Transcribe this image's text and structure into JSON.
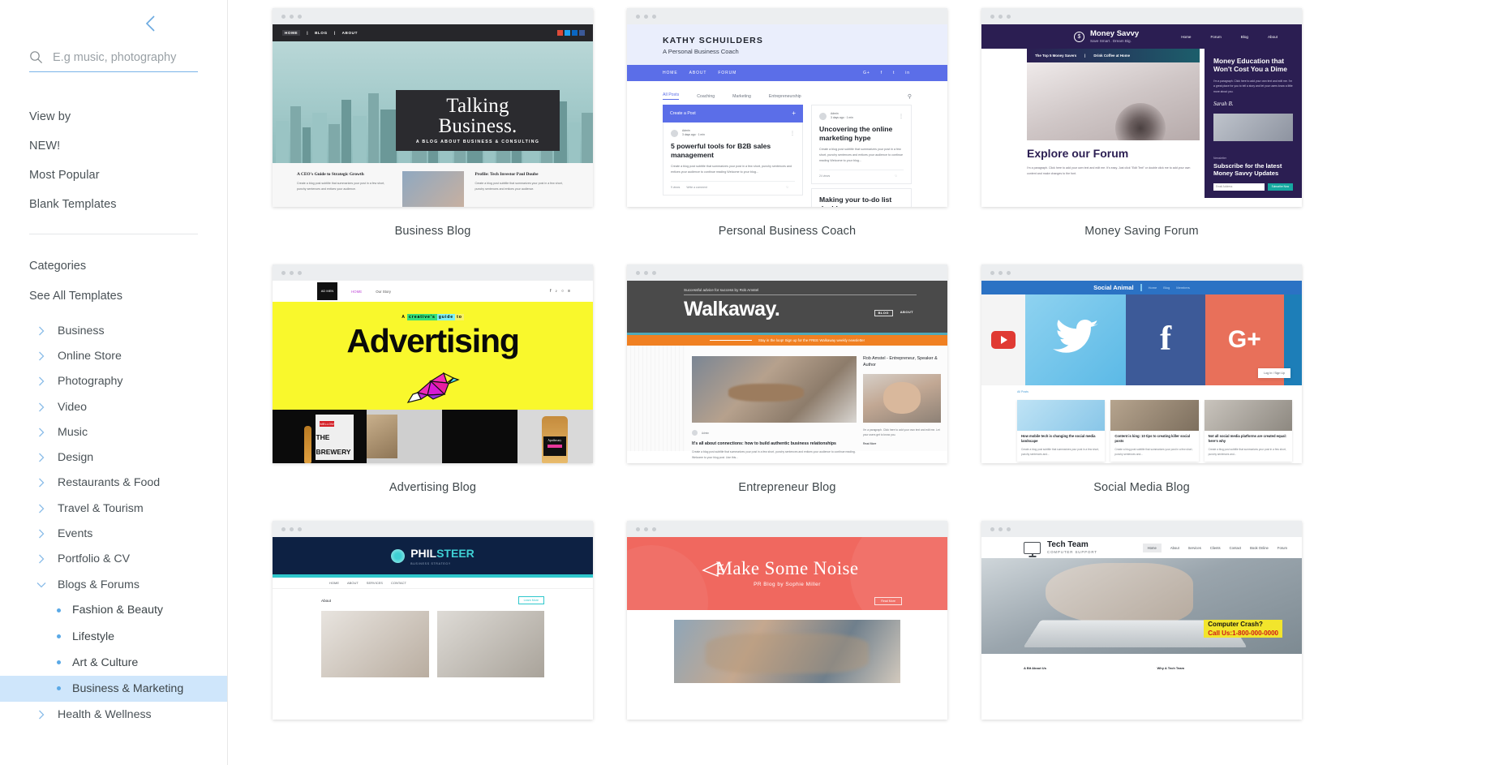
{
  "sidebar": {
    "collapse_icon": "chevron-left-icon",
    "search": {
      "icon": "search-icon",
      "placeholder": "E.g music, photography",
      "value": ""
    },
    "view_by": {
      "title": "View by",
      "items": [
        "NEW!",
        "Most Popular",
        "Blank Templates"
      ]
    },
    "categories": {
      "title": "Categories",
      "see_all": "See All Templates",
      "items": [
        {
          "label": "Business",
          "state": "collapsed"
        },
        {
          "label": "Online Store",
          "state": "collapsed"
        },
        {
          "label": "Photography",
          "state": "collapsed"
        },
        {
          "label": "Video",
          "state": "collapsed"
        },
        {
          "label": "Music",
          "state": "collapsed"
        },
        {
          "label": "Design",
          "state": "collapsed"
        },
        {
          "label": "Restaurants & Food",
          "state": "collapsed"
        },
        {
          "label": "Travel & Tourism",
          "state": "collapsed"
        },
        {
          "label": "Events",
          "state": "collapsed"
        },
        {
          "label": "Portfolio & CV",
          "state": "collapsed"
        },
        {
          "label": "Blogs & Forums",
          "state": "expanded"
        }
      ],
      "subitems": [
        {
          "label": "Fashion & Beauty",
          "selected": false
        },
        {
          "label": "Lifestyle",
          "selected": false
        },
        {
          "label": "Art & Culture",
          "selected": false
        },
        {
          "label": "Business & Marketing",
          "selected": true
        }
      ],
      "next_item": {
        "label": "Health & Wellness",
        "state": "collapsed"
      }
    }
  },
  "templates": [
    {
      "name": "Business Blog"
    },
    {
      "name": "Personal Business Coach"
    },
    {
      "name": "Money Saving Forum"
    },
    {
      "name": "Advertising Blog"
    },
    {
      "name": "Entrepreneur Blog"
    },
    {
      "name": "Social Media Blog"
    }
  ],
  "thumbnails": {
    "business_blog": {
      "nav": [
        "HOME",
        "BLOG",
        "ABOUT"
      ],
      "title": "Talking Business.",
      "subtitle": "A BLOG ABOUT BUSINESS & CONSULTING",
      "posts": [
        {
          "title": "A CEO's Guide to Strategic Growth",
          "body": "Create a blog post subtitle that summarizes your post in a few short, punchy sentences and entices your audience."
        },
        {
          "title": "Profile: Tech Investor Paul Doube",
          "body": "Create a blog post subtitle that summarizes your post in a few short, punchy sentences and entices your audience."
        }
      ]
    },
    "personal_business_coach": {
      "brand": "KATHY SCHUILDERS",
      "tagline": "A Personal Business Coach",
      "nav": [
        "HOME",
        "ABOUT",
        "FORUM"
      ],
      "social": [
        "G+",
        "f",
        "t",
        "in"
      ],
      "tabs": [
        "All Posts",
        "Coaching",
        "Marketing",
        "Entrepreneurship"
      ],
      "cta": "Create a Post",
      "posts": [
        {
          "author": "Admin",
          "meta": "3 days ago · 1 min",
          "title": "5 powerful tools for B2B sales management",
          "body": "Create a blog post subtitle that summarizes your post in a few short, punchy sentences and entices your audience to continue reading Welcome to your blog...",
          "views": "9 views",
          "comment": "Write a comment"
        },
        {
          "author": "Admin",
          "meta": "3 days ago · 1 min",
          "title": "Uncovering the online marketing hype",
          "body": "Create a blog post subtitle that summarizes your post in a few short, punchy sentences and entices your audience to continue reading Welcome to your blog...",
          "views": "24 views"
        },
        {
          "title": "Making your to-do list doable"
        }
      ]
    },
    "money_saving_forum": {
      "brand": "Money Savvy",
      "tagline": "Save Smart . Dream Big.",
      "nav": [
        "Home",
        "Forum",
        "Blog",
        "About"
      ],
      "subnav": [
        "The Top 5 Money Savers",
        "Drink Coffee at Home"
      ],
      "heading": "Explore our Forum",
      "paragraph": "I'm a paragraph. Click here to add your own text and edit me. It's easy. Just click \"Edit Text\" or double click me to add your own content and make changes to the font.",
      "card_title": "Money Education that Won't Cost You a Dime",
      "card_body": "I'm a paragraph. Click here to add your own text and edit me. I'm a great place for you to tell a story and let your users know a little more about you.",
      "signature": "Sarah B.",
      "newsletter_label": "Newsletter",
      "newsletter_title": "Subscribe for the latest Money Savvy Updates",
      "email_placeholder": "Email Address",
      "subscribe_button": "Subscribe Now"
    },
    "advertising_blog": {
      "logo": "AD MEN",
      "nav": [
        "HOME",
        "Our Story"
      ],
      "kicker": "A creative's guide to",
      "title": "Advertising",
      "cards": [
        "THE BREWERY",
        "Apothecary"
      ]
    },
    "entrepreneur_blog": {
      "kicker": "Successful advice for success by Rob Amstel",
      "title": "Walkaway.",
      "nav": [
        "BLOG",
        "ABOUT"
      ],
      "banner": "Stay in the loop! Sign up for the FREE Walkaway weekly newsletter",
      "author": "Rob Amstel - Entrepreneur, Speaker & Author",
      "post_title": "It's all about connections: how to build authentic business relationships",
      "post_body": "Create a blog post subtitle that summarizes your post in a few short, punchy sentences and entices your audience to continue reading. Welcome to your blog post. Use this...",
      "bio": "I'm a paragraph. Click here to add your own text and edit me. Let your users get to know you.",
      "read_more": "Read More"
    },
    "social_media_blog": {
      "brand": "Social Animal",
      "nav": [
        "Home",
        "Blog",
        "Members"
      ],
      "tabs": "All Posts",
      "posts": [
        {
          "title": "How mobile tech is changing the social media landscape",
          "body": "Create a blog post subtitle that summarizes your post in a few short, punchy sentences and..."
        },
        {
          "title": "Content is king: 10 tips to creating killer social posts",
          "body": "Create a blog post subtitle that summarizes your post in a few short, punchy sentences and..."
        },
        {
          "title": "Not all social media platforms are created equal: here's why",
          "body": "Create a blog post subtitle that summarizes your post in a few short, punchy sentences and..."
        }
      ],
      "login": "Log In / Sign Up"
    },
    "philsteer": {
      "brand_a": "PHIL",
      "brand_b": "STEER",
      "tagline": "BUSINESS STRATEGY",
      "nav": [
        "HOME",
        "ABOUT",
        "SERVICES",
        "CONTACT"
      ],
      "section": "About",
      "button": "Learn More"
    },
    "make_some_noise": {
      "title": "Make Some Noise",
      "subtitle": "PR Blog by Sophie Miller",
      "button": "Read More"
    },
    "tech_team": {
      "brand": "Tech Team",
      "tagline": "COMPUTER SUPPORT",
      "nav": [
        "Home",
        "About",
        "Services",
        "Clients",
        "Contact",
        "Book Online",
        "Forum"
      ],
      "crash_line1": "Computer Crash?",
      "crash_line2": "Call Us:1-800-000-0000",
      "footer": [
        "A Bit About Us",
        "Why A Tech Team"
      ]
    }
  },
  "colors": {
    "accent_blue": "#5aa9e6",
    "selected_row": "#cfe6fb",
    "text": "#4a5257"
  }
}
